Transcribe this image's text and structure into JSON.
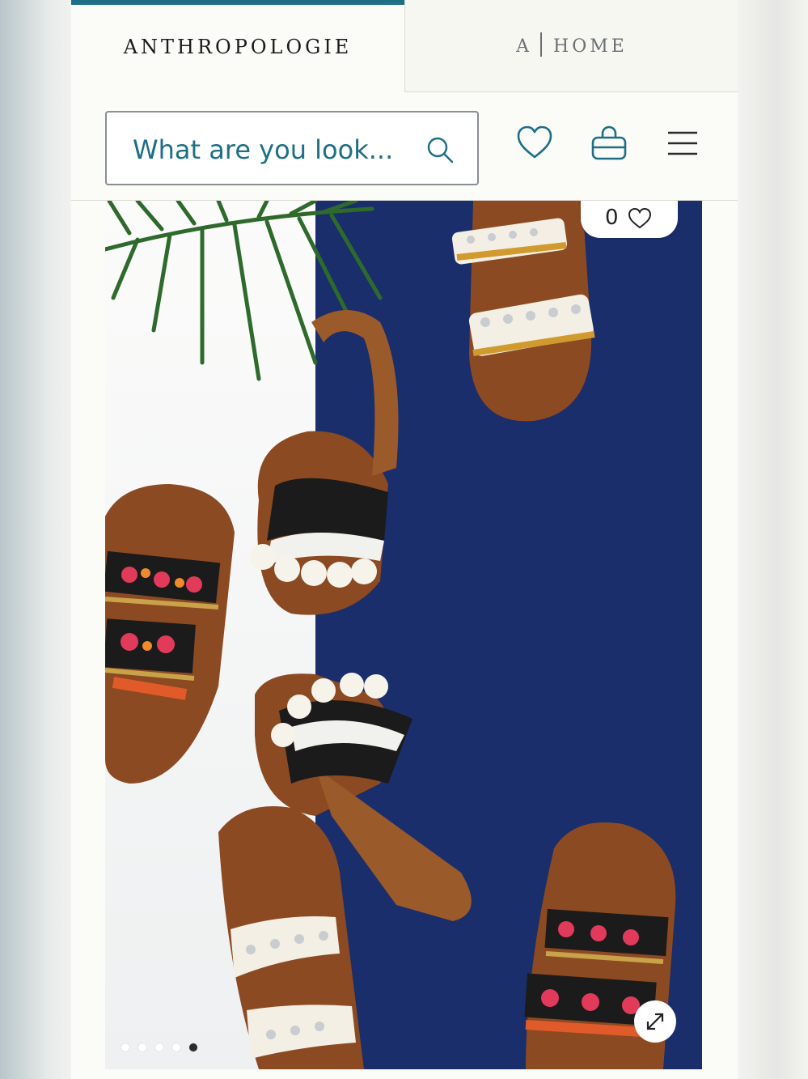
{
  "tabs": {
    "brand_label": "ANTHROPOLOGIE",
    "home_prefix": "A",
    "home_label": "HOME"
  },
  "header": {
    "search_placeholder": "What are you look...",
    "icons": [
      "search-icon",
      "heart-icon",
      "shopping-bag-icon",
      "hamburger-menu-icon"
    ]
  },
  "hero": {
    "favorite_count": "0",
    "carousel_dots": 5,
    "active_dot_index": 4,
    "colors": {
      "accent": "#1e6f86",
      "background_navy": "#1a2e6b",
      "panel_white": "#fbfbfa"
    }
  }
}
